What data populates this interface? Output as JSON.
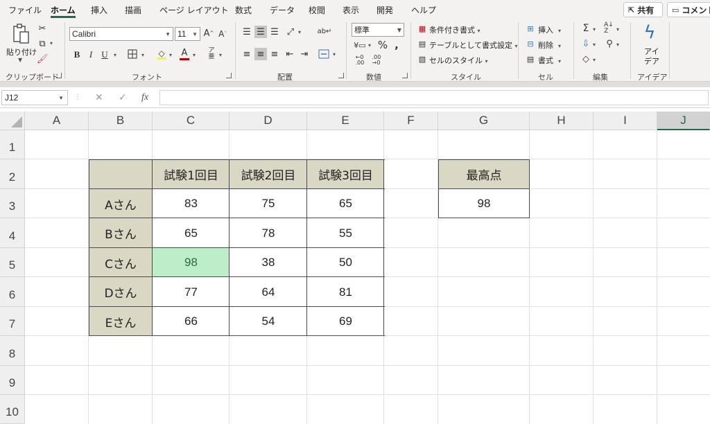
{
  "menu": {
    "tabs": [
      "ファイル",
      "ホーム",
      "挿入",
      "描画",
      "ページ レイアウト",
      "数式",
      "データ",
      "校閲",
      "表示",
      "開発",
      "ヘルプ"
    ],
    "active_tab": "ホーム",
    "share_label": "共有",
    "comment_label": "コメント"
  },
  "ribbon": {
    "clipboard": {
      "label": "クリップボード",
      "paste_label": "貼り付け"
    },
    "font": {
      "label": "フォント",
      "font_name": "Calibri",
      "font_size": "11"
    },
    "alignment": {
      "label": "配置"
    },
    "number": {
      "label": "数値",
      "format": "標準"
    },
    "styles": {
      "label": "スタイル",
      "conditional": "条件付き書式",
      "as_table": "テーブルとして書式設定",
      "cell_styles": "セルのスタイル"
    },
    "cells": {
      "label": "セル",
      "insert": "挿入",
      "delete": "削除",
      "format": "書式"
    },
    "editing": {
      "label": "編集"
    },
    "ideas": {
      "label": "アイデア",
      "button_line1": "アイ",
      "button_line2": "デア"
    }
  },
  "formula_bar": {
    "name_box": "J12",
    "fx": "fx",
    "cancel": "✕",
    "enter": "✓",
    "value": ""
  },
  "grid": {
    "columns": [
      "A",
      "B",
      "C",
      "D",
      "E",
      "F",
      "G",
      "H",
      "I",
      "J"
    ],
    "selected_column": "J",
    "rows": [
      "1",
      "2",
      "3",
      "4",
      "5",
      "6",
      "7",
      "8",
      "9",
      "10"
    ]
  },
  "table": {
    "headers": [
      "",
      "試験1回目",
      "試験2回目",
      "試験3回目"
    ],
    "rows": [
      {
        "name": "Aさん",
        "scores": [
          "83",
          "75",
          "65"
        ]
      },
      {
        "name": "Bさん",
        "scores": [
          "65",
          "78",
          "55"
        ]
      },
      {
        "name": "Cさん",
        "scores": [
          "98",
          "38",
          "50"
        ]
      },
      {
        "name": "Dさん",
        "scores": [
          "77",
          "64",
          "81"
        ]
      },
      {
        "name": "Eさん",
        "scores": [
          "66",
          "54",
          "69"
        ]
      }
    ],
    "highlight_color": "#bdedc9",
    "header_color": "#dbd7c5"
  },
  "max_box": {
    "label": "最高点",
    "value": "98"
  },
  "colors": {
    "accent": "#1e6c41",
    "chrome": "#f3f2f1"
  }
}
